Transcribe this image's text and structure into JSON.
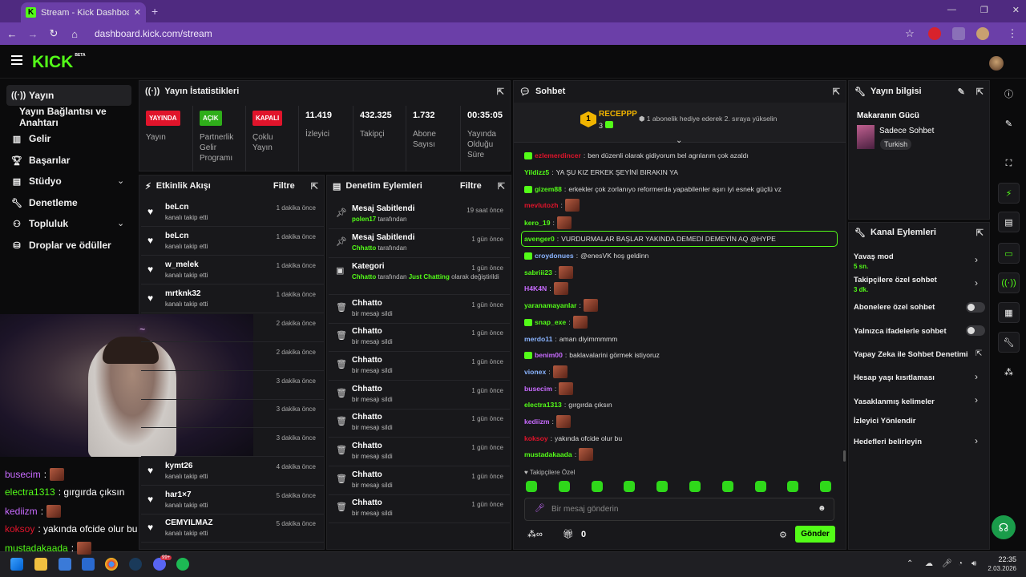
{
  "browser": {
    "tab_title": "Stream - Kick Dashboard",
    "url": "dashboard.kick.com/stream"
  },
  "brand": {
    "logo": "KICK",
    "beta": "BETA",
    "accent": "#53fc18"
  },
  "nav": {
    "items": [
      {
        "label": "Yayın",
        "icon": "broadcast-icon"
      },
      {
        "label": "Yayın Bağlantısı ve Anahtarı"
      },
      {
        "label": "Gelir",
        "icon": "chart-icon"
      },
      {
        "label": "Başarılar",
        "icon": "trophy-icon"
      },
      {
        "label": "Stüdyo",
        "icon": "studio-icon"
      },
      {
        "label": "Denetleme",
        "icon": "wrench-icon"
      },
      {
        "label": "Topluluk",
        "icon": "community-icon"
      },
      {
        "label": "Droplar ve ödüller",
        "icon": "gift-icon"
      }
    ]
  },
  "stats": {
    "title": "Yayın İstatistikleri",
    "cells": [
      {
        "badge": "YAYINDA",
        "label": "Yayın",
        "color": "#e0142b"
      },
      {
        "badge": "AÇIK",
        "label": "Partnerlik Gelir Programı",
        "color": "#2fae1a"
      },
      {
        "badge": "KAPALI",
        "label": "Çoklu Yayın",
        "color": "#e0142b"
      },
      {
        "value": "11.419",
        "label": "İzleyici"
      },
      {
        "value": "432.325",
        "label": "Takipçi"
      },
      {
        "value": "1.732",
        "label": "Abone Sayısı"
      },
      {
        "value": "00:35:05",
        "label": "Yayında Olduğu Süre"
      }
    ]
  },
  "activity": {
    "title": "Etkinlik Akışı",
    "filter": "Filtre",
    "items": [
      {
        "name": "beLcn",
        "action": "kanalı takip etti",
        "time": "1 dakika önce"
      },
      {
        "name": "beLcn",
        "action": "kanalı takip etti",
        "time": "1 dakika önce"
      },
      {
        "name": "w_melek",
        "action": "kanalı takip etti",
        "time": "1 dakika önce"
      },
      {
        "name": "mrtknk32",
        "action": "kanalı takip etti",
        "time": "1 dakika önce"
      },
      {
        "time": "2 dakika önce"
      },
      {
        "time": "2 dakika önce"
      },
      {
        "time": "3 dakika önce"
      },
      {
        "time": "3 dakika önce"
      },
      {
        "time": "3 dakika önce"
      },
      {
        "name": "kymt26",
        "action": "kanalı takip etti",
        "time": "4 dakika önce"
      },
      {
        "name": "har1×7",
        "action": "kanalı takip etti",
        "time": "5 dakika önce"
      },
      {
        "name": "CEMYILMAZ",
        "action": "kanalı takip etti",
        "time": "5 dakika önce"
      }
    ]
  },
  "moderation": {
    "title": "Denetim Eylemleri",
    "filter": "Filtre",
    "items": [
      {
        "title": "Mesaj Sabitlendi",
        "user": "polen17",
        "suffix": "tarafından",
        "time": "19 saat önce"
      },
      {
        "title": "Mesaj Sabitlendi",
        "user": "Chhatto",
        "suffix": "tarafından",
        "time": "1 gün önce"
      },
      {
        "title": "Kategori",
        "user": "Chhatto",
        "mid": "tarafından",
        "cat": "Just Chatting",
        "end": "olarak değiştirildi",
        "time": "1 gün önce"
      },
      {
        "title": "Chhatto",
        "sub": "bir mesajı sildi",
        "time": "1 gün önce"
      },
      {
        "title": "Chhatto",
        "sub": "bir mesajı sildi",
        "time": "1 gün önce"
      },
      {
        "title": "Chhatto",
        "sub": "bir mesajı sildi",
        "time": "1 gün önce"
      },
      {
        "title": "Chhatto",
        "sub": "bir mesajı sildi",
        "time": "1 gün önce"
      },
      {
        "title": "Chhatto",
        "sub": "bir mesajı sildi",
        "time": "1 gün önce"
      },
      {
        "title": "Chhatto",
        "sub": "bir mesajı sildi",
        "time": "1 gün önce"
      },
      {
        "title": "Chhatto",
        "sub": "bir mesajı sildi",
        "time": "1 gün önce"
      },
      {
        "title": "Chhatto",
        "sub": "bir mesajı sildi",
        "time": "1 gün önce"
      }
    ]
  },
  "chat": {
    "title": "Sohbet",
    "pinned": {
      "rank": "1",
      "user": "RECEPPP",
      "count": "3",
      "msg": "1 abonelik hediye ederek 2. sıraya yükselin"
    },
    "messages": [
      {
        "u": "ezlemerdincer",
        "c": "#e0142b",
        "t": "ben düzenli olarak gidiyorum bel agrılarım çok azaldı"
      },
      {
        "u": "Yildizz5",
        "c": "#53fc18",
        "t": "YA ŞU KIZ ERKEK ŞEYİNİ BIRAKIN YA"
      },
      {
        "u": "gizem88",
        "c": "#53fc18",
        "t": "erkekler çok zorlanıyo reformerda yapabilenler aşırı iyi esnek güçlü vz"
      },
      {
        "u": "mevlutozh",
        "c": "#e0142b",
        "t": ""
      },
      {
        "u": "kero_19",
        "c": "#53fc18",
        "t": ""
      },
      {
        "u": "avenger0",
        "c": "#53fc18",
        "t": "VURDURMALAR BAŞLAR YAKINDA DEMEDİ DEMEYİN AQ @HYPE"
      },
      {
        "u": "croydonues",
        "c": "#8ab4ff",
        "t": "@enesVK hoş geldinn"
      },
      {
        "u": "sabriii23",
        "c": "#53fc18",
        "t": ""
      },
      {
        "u": "H4K4N",
        "c": "#c86bff",
        "t": ""
      },
      {
        "u": "yaranamayanlar",
        "c": "#53fc18",
        "t": ""
      },
      {
        "u": "snap_exe",
        "c": "#53fc18",
        "t": ""
      },
      {
        "u": "merdo11",
        "c": "#8ab4ff",
        "t": "aman diyimmmmm"
      },
      {
        "u": "benim00",
        "c": "#c86bff",
        "t": "baklavalarini görmek istiyoruz"
      },
      {
        "u": "vionex",
        "c": "#8ab4ff",
        "t": ""
      },
      {
        "u": "busecim",
        "c": "#c86bff",
        "t": ""
      },
      {
        "u": "electra1313",
        "c": "#53fc18",
        "t": "gırgırda çıksın"
      },
      {
        "u": "kediizm",
        "c": "#c86bff",
        "t": ""
      },
      {
        "u": "koksoy",
        "c": "#e0142b",
        "t": "yakında ofcide olur bu"
      },
      {
        "u": "mustadakaada",
        "c": "#53fc18",
        "t": ""
      }
    ],
    "followers_only": "Takipçilere Özel",
    "placeholder": "Bir mesaj gönderin",
    "points": "0",
    "send": "Gönder"
  },
  "streaminfo": {
    "title": "Yayın bilgisi",
    "stream_title": "Makaranın Gücü",
    "category": "Sadece Sohbet",
    "tag": "Turkish"
  },
  "channel_actions": {
    "title": "Kanal Eylemleri",
    "items": [
      {
        "label": "Yavaş mod",
        "sub": "5 sn."
      },
      {
        "label": "Takipçilere özel sohbet",
        "sub": "3 dk."
      },
      {
        "label": "Abonelere özel sohbet"
      },
      {
        "label": "Yalnızca ifadelerle sohbet"
      },
      {
        "label": "Yapay Zeka ile Sohbet Denetimi"
      },
      {
        "label": "Hesap yaşı kısıtlaması"
      },
      {
        "label": "Yasaklanmış kelimeler"
      },
      {
        "label": "İzleyici Yönlendir"
      },
      {
        "label": "Hedefleri belirleyin"
      }
    ]
  },
  "overlay_chat": [
    {
      "u": "busecim",
      "c": "#c86bff",
      "t": ":"
    },
    {
      "u": "electra1313",
      "c": "#53fc18",
      "t": ": gırgırda çıksın"
    },
    {
      "u": "kediizm",
      "c": "#c86bff",
      "t": ":"
    },
    {
      "u": "koksoy",
      "c": "#e0142b",
      "t": ": yakında ofcide olur bu"
    },
    {
      "u": "mustadakaada",
      "c": "#53fc18",
      "t": ":"
    }
  ],
  "taskbar": {
    "time": "22:35",
    "date": "2.03.2026",
    "badge": "99+"
  }
}
